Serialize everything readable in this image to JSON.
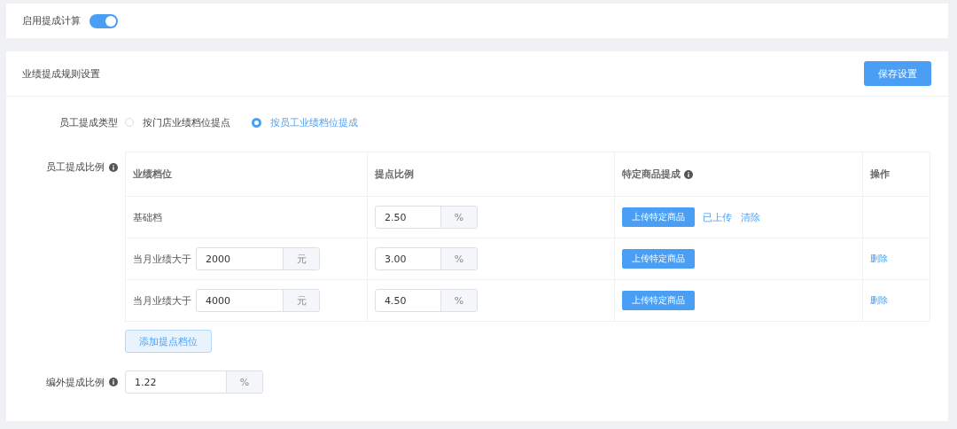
{
  "enable_toggle": {
    "label": "启用提成计算",
    "on": true
  },
  "rules_panel": {
    "title": "业绩提成规则设置",
    "save_button": "保存设置",
    "type_field": {
      "label": "员工提成类型",
      "options": [
        {
          "label": "按门店业绩档位提点",
          "selected": false
        },
        {
          "label": "按员工业绩档位提成",
          "selected": true
        }
      ]
    },
    "ratio_field": {
      "label": "员工提成比例",
      "info": true,
      "table": {
        "columns": [
          {
            "label": "业绩档位",
            "info": false
          },
          {
            "label": "提点比例",
            "info": false
          },
          {
            "label": "特定商品提成",
            "info": true
          },
          {
            "label": "操作",
            "info": false
          }
        ],
        "rows": [
          {
            "kind": "base",
            "tier": "基础档",
            "rate": "2.50",
            "rate_unit": "%",
            "upload_button": "上传特定商品",
            "uploaded": "已上传",
            "clear_link": "清除"
          },
          {
            "kind": "threshold",
            "tier": "当月业绩大于",
            "amount": "2000",
            "amount_unit": "元",
            "rate": "3.00",
            "rate_unit": "%",
            "upload_button": "上传特定商品",
            "delete_link": "删除"
          },
          {
            "kind": "threshold",
            "tier": "当月业绩大于",
            "amount": "4000",
            "amount_unit": "元",
            "rate": "4.50",
            "rate_unit": "%",
            "upload_button": "上传特定商品",
            "delete_link": "删除"
          }
        ]
      },
      "add_button": "添加提点档位"
    },
    "extra_field": {
      "label": "编外提成比例",
      "info": true,
      "value": "1.22",
      "unit": "%"
    }
  }
}
